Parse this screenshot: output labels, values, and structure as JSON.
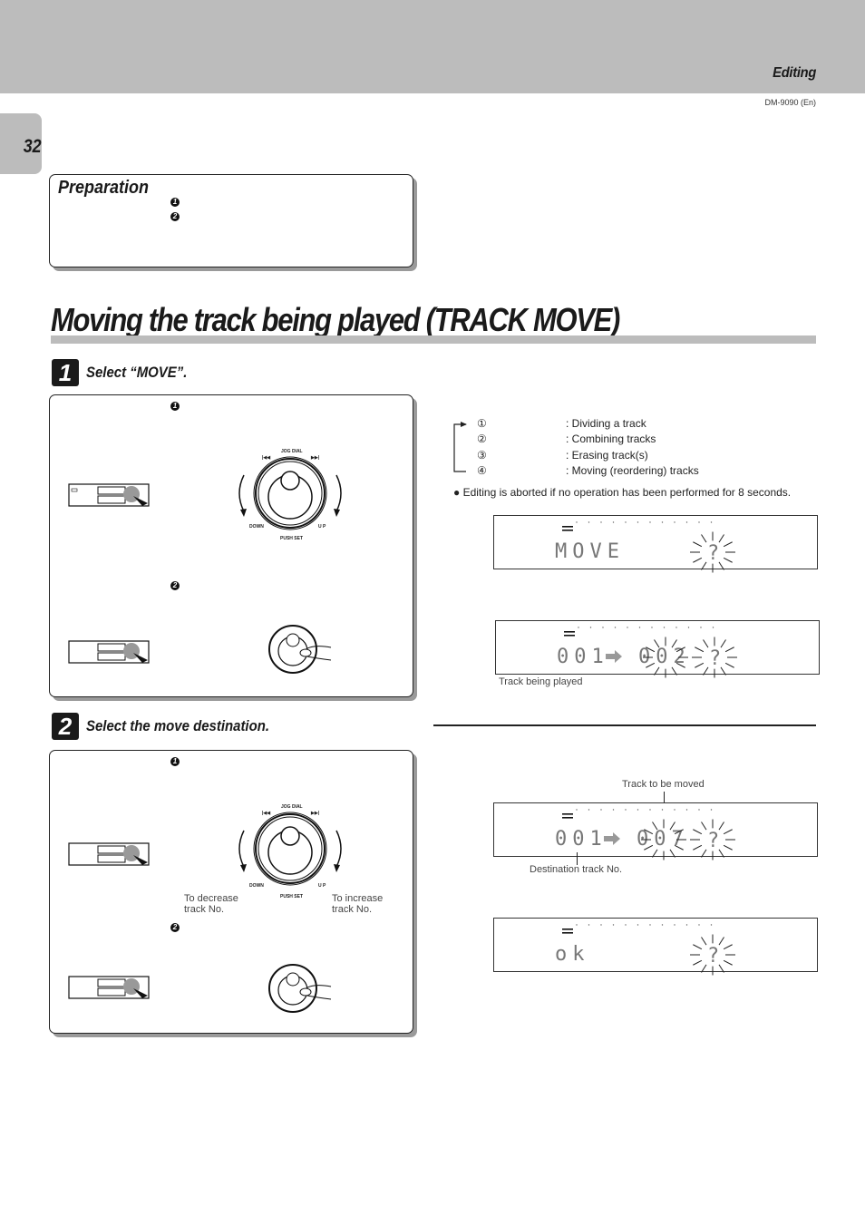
{
  "header": {
    "section": "Editing",
    "model": "DM-9090 (En)",
    "page_number": "32"
  },
  "preparation": {
    "title": "Preparation",
    "steps": [
      "1",
      "2"
    ]
  },
  "title": "Moving the track being played (TRACK MOVE)",
  "step1": {
    "number": "1",
    "title": "Select “MOVE”.",
    "substeps": [
      "1",
      "2"
    ],
    "jog_dial": {
      "label": "JOG DIAL",
      "down": "DOWN",
      "up": "U P",
      "push_set": "PUSH SET",
      "prev_icon": "⏮",
      "next_icon": "⏭"
    }
  },
  "step2": {
    "number": "2",
    "title": "Select the move destination.",
    "substeps": [
      "1",
      "2"
    ],
    "decrease_caption": "To decrease track No.",
    "increase_caption": "To increase track No."
  },
  "edit_modes": [
    {
      "num": "①",
      "desc": ": Dividing a track"
    },
    {
      "num": "②",
      "desc": ": Combining tracks"
    },
    {
      "num": "③",
      "desc": ": Erasing track(s)"
    },
    {
      "num": "④",
      "desc": ": Moving (reordering) tracks"
    }
  ],
  "note": "● Editing is aborted if no operation has been performed for 8 seconds.",
  "displays": [
    {
      "left": "MOVE",
      "blink": "?"
    },
    {
      "left": "001",
      "arrow": true,
      "middle": "002",
      "blink": "?",
      "caption": "Track being played"
    },
    {
      "left": "001",
      "arrow": true,
      "middle": "007",
      "blink": "?",
      "caption_top": "Track to be moved",
      "caption_bottom": "Destination track No."
    },
    {
      "left": "ok",
      "blink": "?"
    }
  ]
}
